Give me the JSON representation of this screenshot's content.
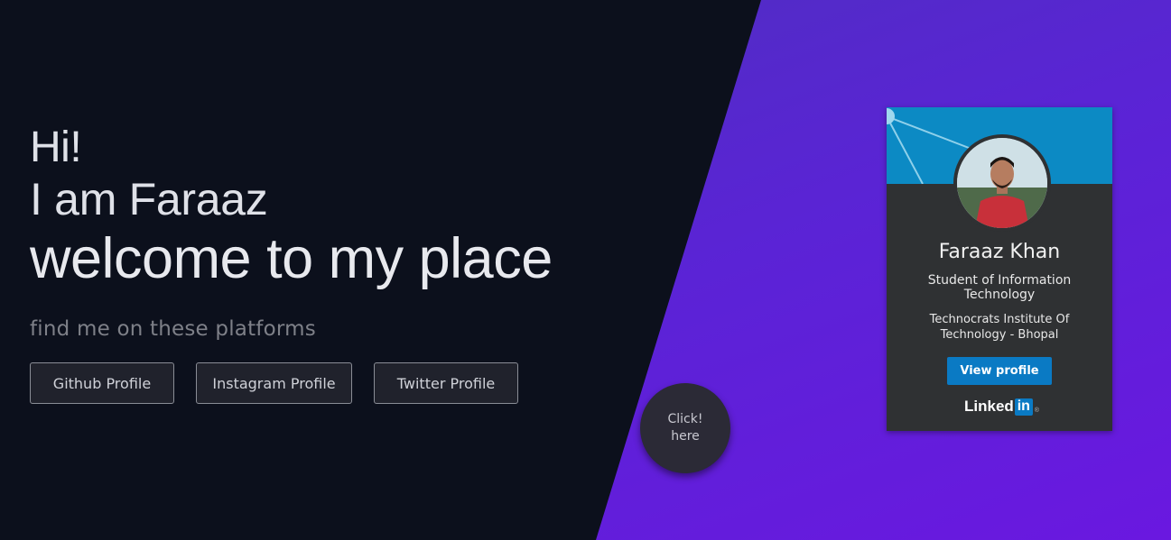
{
  "hero": {
    "greeting": "Hi!",
    "intro": "I am Faraaz",
    "welcome": "welcome to my place"
  },
  "platforms": {
    "subtitle": "find me on these platforms",
    "buttons": [
      {
        "label": "Github Profile"
      },
      {
        "label": "Instagram Profile"
      },
      {
        "label": "Twitter Profile"
      }
    ]
  },
  "click_button": {
    "line1": "Click!",
    "line2": "here"
  },
  "linkedin_card": {
    "name": "Faraaz Khan",
    "title": "Student of Information Technology",
    "school": "Technocrats Institute Of Technology - Bhopal",
    "button": "View profile",
    "logo_text": "Linked",
    "logo_in": "in",
    "logo_mark": "®"
  },
  "colors": {
    "background": "#0c101c",
    "accent_purple": "#5b23d6",
    "linkedin_blue": "#0a7ac4"
  }
}
